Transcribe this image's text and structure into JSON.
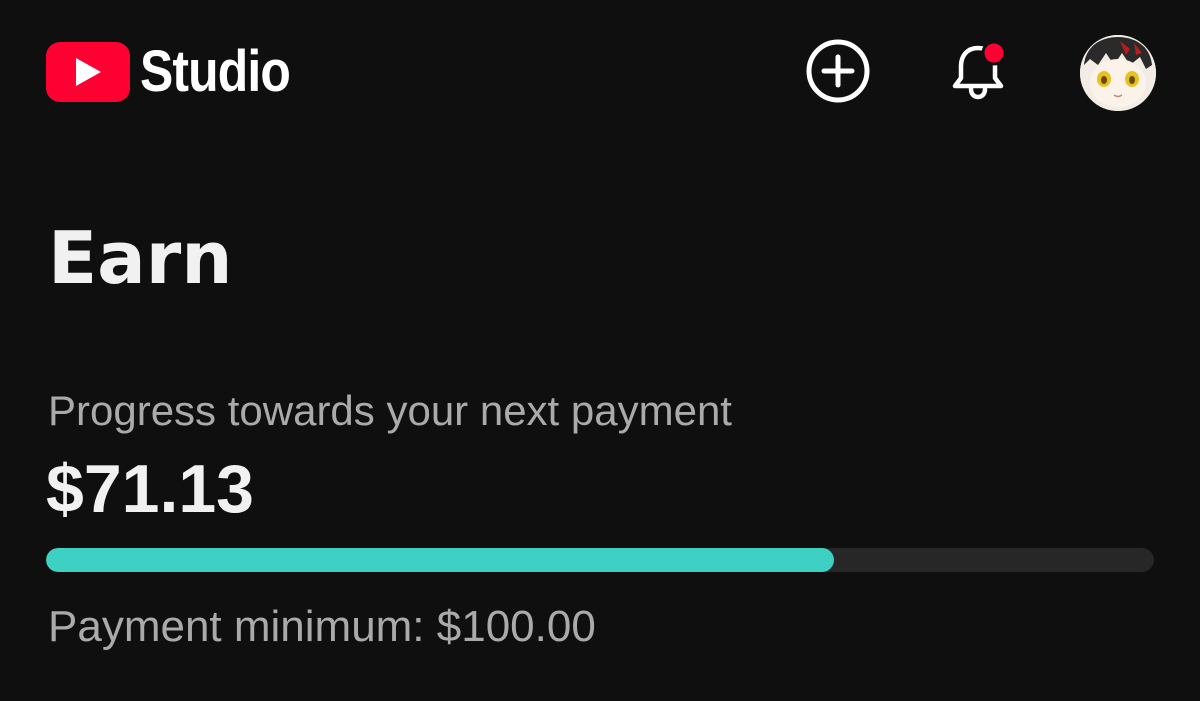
{
  "header": {
    "logo_text": "Studio",
    "brand_color": "#ff0033",
    "icons": {
      "logo": "youtube-play-icon",
      "create": "add-circle-icon",
      "notifications": "bell-icon",
      "account": "avatar"
    },
    "notification_dot_color": "#ff0033"
  },
  "main": {
    "title": "Earn",
    "progress_label": "Progress towards your next payment",
    "current_amount": "$71.13",
    "current_value": 71.13,
    "payment_minimum_label": "Payment minimum: $100.00",
    "payment_minimum_value": 100.0,
    "progress_color": "#3ed1c3"
  }
}
